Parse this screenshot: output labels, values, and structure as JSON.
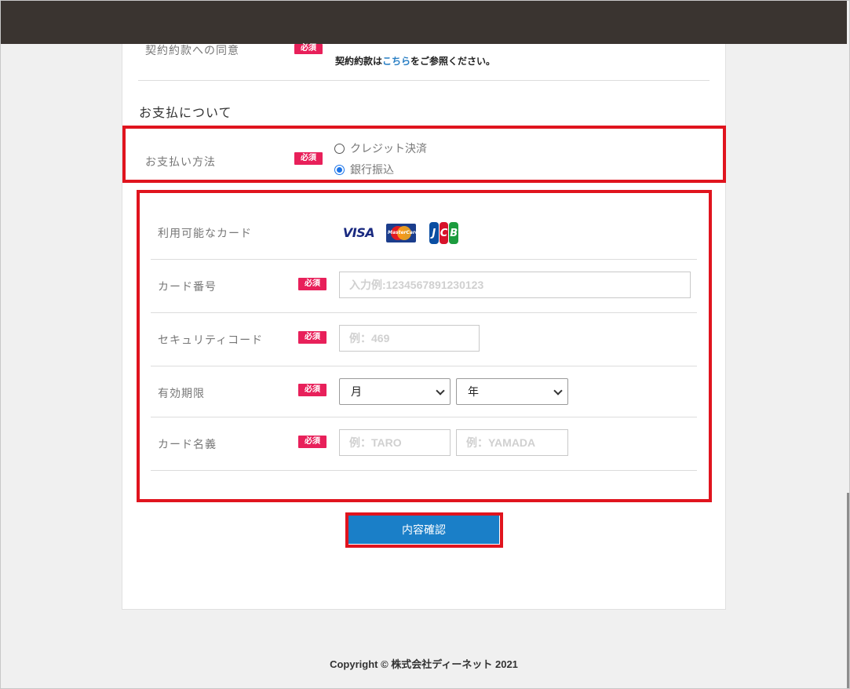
{
  "agreement": {
    "label": "契約約款への同意",
    "required": "必須",
    "note_prefix": "契約約款は",
    "note_link": "こちら",
    "note_suffix": "をご参照ください。"
  },
  "payment_section": {
    "title": "お支払について",
    "method_label": "お支払い方法",
    "required": "必須",
    "options": [
      {
        "label": "クレジット決済",
        "checked": false
      },
      {
        "label": "銀行振込",
        "checked": true
      }
    ]
  },
  "card_form": {
    "available_label": "利用可能なカード",
    "logos": [
      "VISA",
      "MasterCard",
      "JCB"
    ],
    "card_number": {
      "label": "カード番号",
      "required": "必須",
      "placeholder": "入力例:1234567891230123"
    },
    "security_code": {
      "label": "セキュリティコード",
      "required": "必須",
      "placeholder": "例：469"
    },
    "expiry": {
      "label": "有効期限",
      "required": "必須",
      "month": "月",
      "year": "年"
    },
    "holder": {
      "label": "カード名義",
      "required": "必須",
      "first_placeholder": "例：TARO",
      "last_placeholder": "例：YAMADA"
    }
  },
  "confirm_button": "内容確認",
  "footer": "Copyright © 株式会社ディーネット 2021",
  "colors": {
    "header": "#3a3430",
    "required_badge": "#e8205a",
    "highlight": "#e0141e",
    "button": "#1a7fc8",
    "link": "#2a7fc4"
  }
}
